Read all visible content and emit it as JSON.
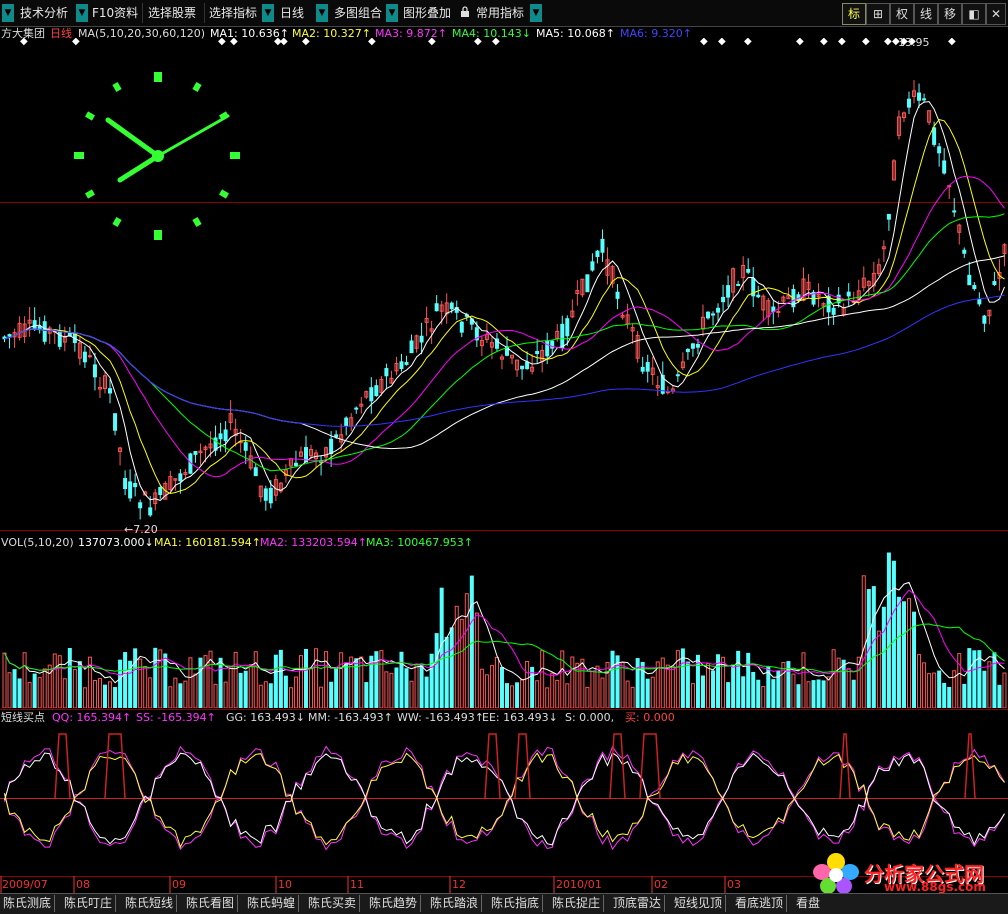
{
  "toolbar": {
    "items": [
      {
        "label": "技术分析"
      },
      {
        "label": "F10资料"
      },
      {
        "label": "选择股票"
      },
      {
        "label": "选择指标"
      },
      {
        "label": "日线"
      },
      {
        "label": "多图组合"
      },
      {
        "label": "图形叠加"
      },
      {
        "label": "常用指标"
      }
    ],
    "right": [
      "标",
      "⊞",
      "权",
      "线",
      "移",
      "◧",
      "✕"
    ]
  },
  "main_header": {
    "stock_name": "方大集团",
    "period": "日线",
    "ma_params": "MA(5,10,20,30,60,120)",
    "ma1": "MA1: 10.636↑",
    "ma2": "MA2: 10.327↑",
    "ma3": "MA3: 9.872↑",
    "ma4": "MA4: 10.143↓",
    "ma5": "MA5: 10.068↑",
    "ma6": "MA6: 9.320↑"
  },
  "price_annotations": {
    "high": "13.95",
    "low": "←7.20"
  },
  "vol_header": {
    "params": "VOL(5,10,20)",
    "vol": "137073.000↓",
    "ma1": "MA1: 160181.594↑",
    "ma2": "MA2: 133203.594↑",
    "ma3": "MA3: 100467.953↑"
  },
  "ind_header": {
    "name": "短线买点",
    "qq": "QQ: 165.394↑",
    "ss": "SS: -165.394↑",
    "gg": "GG: 163.493↓",
    "mm": "MM: -163.493↑",
    "ww": "WW: -163.493↑",
    "ee": "EE: 163.493↓",
    "s": "S: 0.000,",
    "buy": "买: 0.000"
  },
  "date_axis": [
    "2009/07",
    "08",
    "09",
    "10",
    "11",
    "12",
    "2010/01",
    "02",
    "03"
  ],
  "bottom_tabs": [
    "陈氏测底",
    "陈氏叮庄",
    "陈氏短线",
    "陈氏看图",
    "陈氏蚂蝗",
    "陈氏买卖",
    "陈氏趋势",
    "陈氏踏浪",
    "陈氏指底",
    "陈氏捉庄",
    "顶底雷达",
    "短线见顶",
    "看底逃顶",
    "看盘"
  ],
  "watermark": {
    "text": "分析家公式网",
    "url": "www.88gs.com"
  },
  "colors": {
    "up": "#ff5555",
    "down": "#55ffff",
    "ma1": "#ffffff",
    "ma2": "#ffff00",
    "ma3": "#ff00ff",
    "ma4": "#00ff00",
    "ma5": "#ffffff",
    "ma6": "#3333ff",
    "grid": "#8b0000",
    "clock": "#33ff33"
  }
}
